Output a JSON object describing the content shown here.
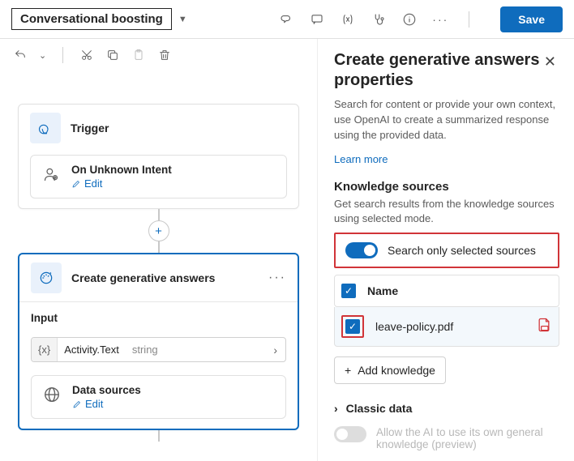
{
  "topbar": {
    "topic_name": "Conversational boosting",
    "save_label": "Save"
  },
  "canvas": {
    "trigger_title": "Trigger",
    "trigger_event_title": "On Unknown Intent",
    "edit_label": "Edit",
    "gen_title": "Create generative answers",
    "input_label": "Input",
    "input_value": "Activity.Text",
    "input_type": "string",
    "data_sources_title": "Data sources"
  },
  "panel": {
    "title": "Create generative answers properties",
    "description": "Search for content or provide your own context, use OpenAI to create a summarized response using the provided data.",
    "learn_more": "Learn more",
    "ks_title": "Knowledge sources",
    "ks_desc": "Get search results from the knowledge sources using selected mode.",
    "toggle_label": "Search only selected sources",
    "name_header": "Name",
    "file_name": "leave-policy.pdf",
    "add_label": "Add knowledge",
    "classic_label": "Classic data",
    "ai_label": "Allow the AI to use its own general knowledge (preview)"
  }
}
